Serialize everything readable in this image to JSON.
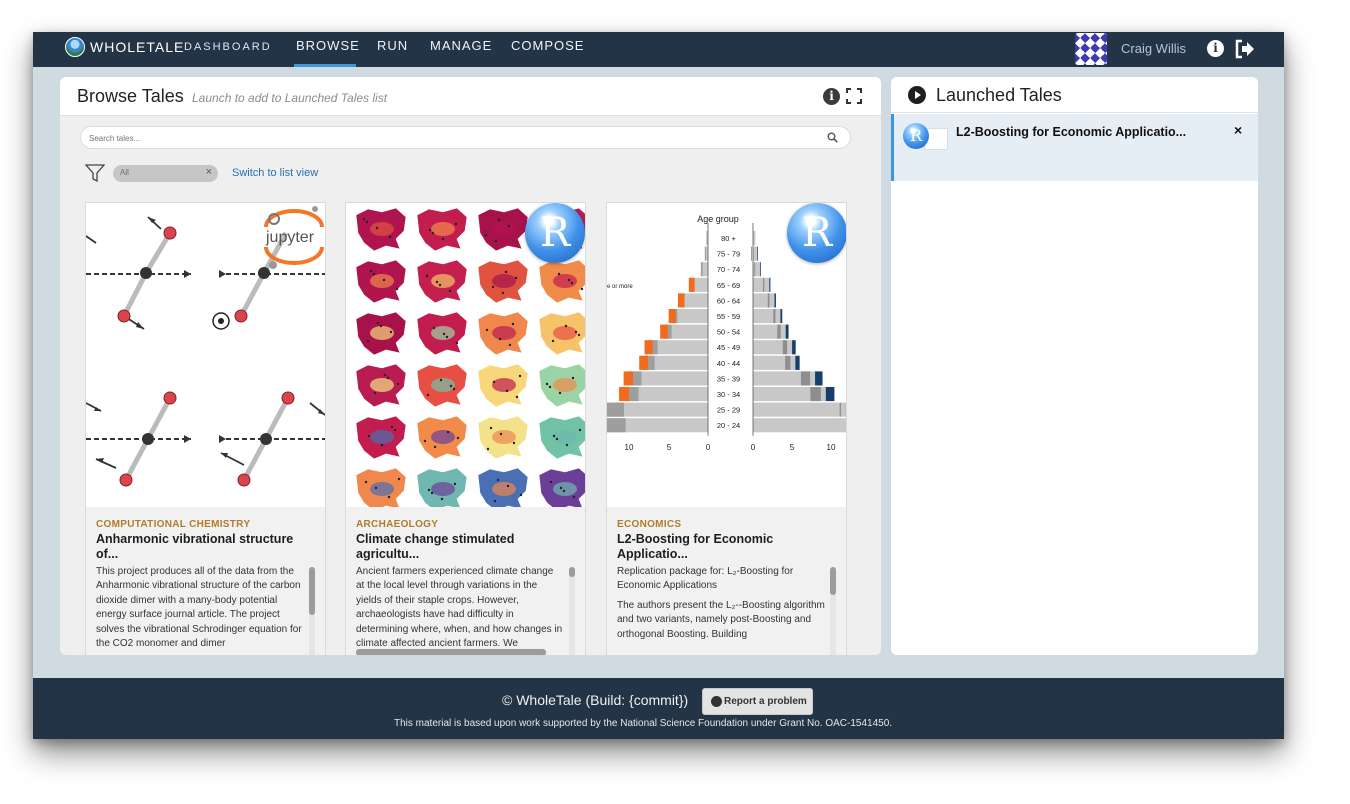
{
  "nav": {
    "brand": "WHOLETALE",
    "dashboard": "DASHBOARD",
    "links": [
      "BROWSE",
      "RUN",
      "MANAGE",
      "COMPOSE"
    ],
    "active": "BROWSE",
    "user_name": "Craig Willis",
    "accent": "#3b97dc",
    "bg": "#243447"
  },
  "browse": {
    "title": "Browse Tales",
    "subtitle": "Launch to add to Launched Tales list",
    "search_placeholder": "Search tales...",
    "filter_tag": "All",
    "switch_view": "Switch to list view"
  },
  "cards": [
    {
      "category": "COMPUTATIONAL CHEMISTRY",
      "title": "Anharmonic vibrational structure of...",
      "description": [
        "This project produces all of the data from the Anharmonic vibrational structure of the carbon dioxide dimer with a many-body potential energy surface journal article. The project solves the vibrational Schrodinger equation for the CO2 monomer and dimer"
      ],
      "badge": "jupyter",
      "image": "co2 molecule vibration diagram"
    },
    {
      "category": "ARCHAEOLOGY",
      "title": "Climate change stimulated agricultu...",
      "description": [
        "Ancient farmers experienced climate change at the local level through variations in the yields of their staple crops. However, archaeologists have had difficulty in determining where, when, and how changes in climate affected ancient farmers. We"
      ],
      "badge": "R",
      "image": "map grid of climate heatmaps"
    },
    {
      "category": "ECONOMICS",
      "title": "L2-Boosting for Economic Applicatio...",
      "description": [
        "Replication package for: L₂-Boosting for Economic Applications",
        "The authors present the L₂--Boosting algorithm and two variants, namely post-Boosting and orthogonal Boosting. Building"
      ],
      "badge": "R",
      "image": "age group population pyramid"
    }
  ],
  "pyramid": {
    "header": "Age group",
    "groups": [
      "80 +",
      "75 - 79",
      "70 - 74",
      "65 - 69",
      "60 - 64",
      "55 - 59",
      "50 - 54",
      "45 - 49",
      "40 - 44",
      "35 - 39",
      "30 - 34",
      "25 - 29",
      "20 - 24"
    ],
    "left_ticks": [
      "10",
      "5",
      "0"
    ],
    "right_ticks": [
      "0",
      "5",
      "10"
    ],
    "side_label": "e or more"
  },
  "launched": {
    "title": "Launched Tales",
    "items": [
      {
        "title": "L2-Boosting for Economic Applicatio..."
      }
    ]
  },
  "footer": {
    "copyright": "© WholeTale (Build: {commit})",
    "report": "Report a problem",
    "nsf": "This material is based upon work supported by the National Science Foundation under Grant No. OAC-1541450."
  },
  "icons": {
    "logo": "wholetale-globe-icon",
    "info": "info-icon",
    "signout": "sign-out-icon",
    "expand": "expand-icon",
    "search": "search-icon",
    "filter": "filter-icon",
    "play": "play-icon",
    "github": "github-icon"
  }
}
